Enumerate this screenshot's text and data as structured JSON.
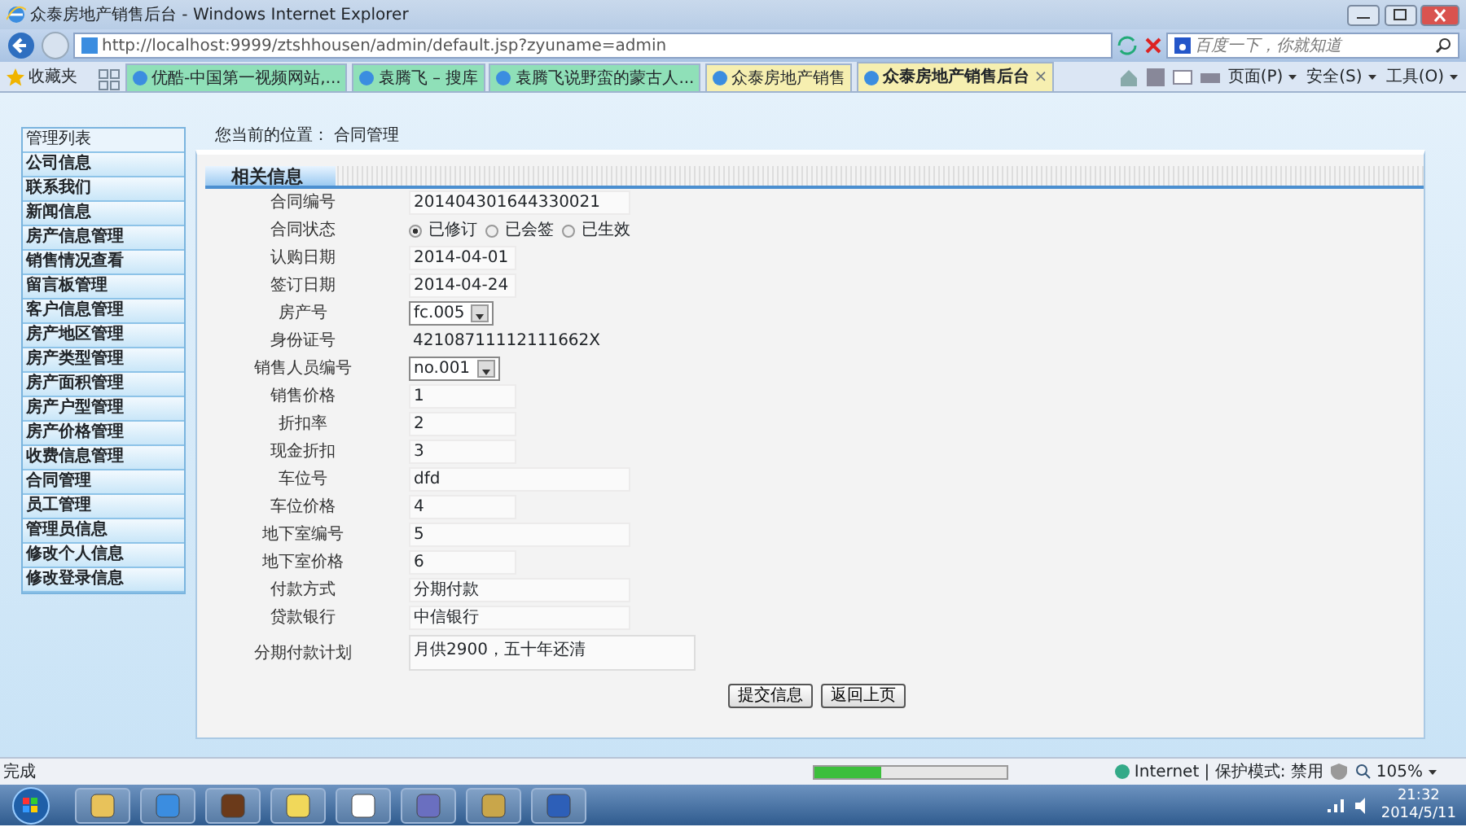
{
  "window": {
    "title": "众泰房地产销售后台 - Windows Internet Explorer"
  },
  "address_bar": {
    "url": "http://localhost:9999/ztshhousen/admin/default.jsp?zyuname=admin",
    "search_placeholder": "百度一下，你就知道"
  },
  "favorites": "收藏夹",
  "tabs": [
    {
      "label": "优酷-中国第一视频网站,...",
      "selected": false,
      "color": "#8fe0b8"
    },
    {
      "label": "袁腾飞 – 搜库",
      "selected": false,
      "color": "#8fe0b8"
    },
    {
      "label": "袁腾飞说野蛮的蒙古人...",
      "selected": false,
      "color": "#8fe0b8"
    },
    {
      "label": "众泰房地产销售",
      "selected": false,
      "color": "#f6efb0"
    },
    {
      "label": "众泰房地产销售后台",
      "selected": true,
      "color": "#f6efb0"
    }
  ],
  "close_tab": "×",
  "command_bar": [
    "页面(P)",
    "安全(S)",
    "工具(O)"
  ],
  "sidebar": {
    "title": "管理列表",
    "items": [
      {
        "label": "公司信息",
        "selected": false
      },
      {
        "label": "联系我们",
        "selected": false
      },
      {
        "label": "新闻信息",
        "selected": false
      },
      {
        "label": "房产信息管理",
        "selected": false
      },
      {
        "label": "销售情况查看",
        "selected": false
      },
      {
        "label": "留言板管理",
        "selected": false
      },
      {
        "label": "客户信息管理",
        "selected": false
      },
      {
        "label": "房产地区管理",
        "selected": false
      },
      {
        "label": "房产类型管理",
        "selected": false
      },
      {
        "label": "房产面积管理",
        "selected": false
      },
      {
        "label": "房产户型管理",
        "selected": false
      },
      {
        "label": "房产价格管理",
        "selected": false
      },
      {
        "label": "收费信息管理",
        "selected": false
      },
      {
        "label": "合同管理",
        "selected": false
      },
      {
        "label": "员工管理",
        "selected": false
      },
      {
        "label": "管理员信息",
        "selected": false
      },
      {
        "label": "修改个人信息",
        "selected": false
      },
      {
        "label": "修改登录信息",
        "selected": false
      }
    ]
  },
  "breadcrumb": "您当前的位置： 合同管理",
  "panel_title": "相关信息",
  "form": [
    {
      "label": "合同编号",
      "kind": "field",
      "value": "201404301644330021"
    },
    {
      "label": "合同状态",
      "kind": "radio",
      "options": [
        {
          "label": "已修订",
          "selected": true
        },
        {
          "label": "已会签",
          "selected": false
        },
        {
          "label": "已生效",
          "selected": false
        }
      ]
    },
    {
      "label": "认购日期",
      "kind": "short",
      "value": "2014-04-01"
    },
    {
      "label": "签订日期",
      "kind": "short",
      "value": "2014-04-24"
    },
    {
      "label": "房产号",
      "kind": "select",
      "value": "fc.005"
    },
    {
      "label": "身份证号",
      "kind": "static",
      "value": "42108711112111662X"
    },
    {
      "label": "销售人员编号",
      "kind": "select",
      "value": "no.001"
    },
    {
      "label": "销售价格",
      "kind": "short",
      "value": "1"
    },
    {
      "label": "折扣率",
      "kind": "short",
      "value": "2"
    },
    {
      "label": "现金折扣",
      "kind": "short",
      "value": "3"
    },
    {
      "label": "车位号",
      "kind": "field",
      "value": "dfd"
    },
    {
      "label": "车位价格",
      "kind": "short",
      "value": "4"
    },
    {
      "label": "地下室编号",
      "kind": "field",
      "value": "5"
    },
    {
      "label": "地下室价格",
      "kind": "short",
      "value": "6"
    },
    {
      "label": "付款方式",
      "kind": "field",
      "value": "分期付款"
    },
    {
      "label": "贷款银行",
      "kind": "field",
      "value": "中信银行"
    },
    {
      "label": "分期付款计划",
      "kind": "textarea",
      "value": "月供2900，五十年还清"
    }
  ],
  "buttons": [
    "提交信息",
    "返回上页"
  ],
  "status_bar": {
    "text": "完成",
    "level": 0.35,
    "zone": "Internet | 保护模式: 禁用",
    "zoom": "105%"
  },
  "taskbar": {
    "time": "21:32",
    "date": "2014/5/11"
  }
}
